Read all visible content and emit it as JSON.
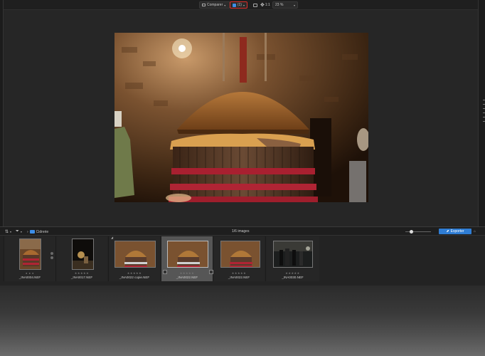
{
  "toolbar": {
    "compare_label": "Comparer",
    "view_mode_label": "(1)",
    "ratio_label": "1:1",
    "zoom_value": "23 %"
  },
  "filmstrip_bar": {
    "folder_name": "Cidrerie",
    "image_count": "1/6 images",
    "export_label": "Exporter"
  },
  "thumbnails": [
    {
      "filename": "_INA0004.NEF",
      "stars": "● ● ●",
      "selected": false
    },
    {
      "filename": "_INA0017.NEF",
      "stars": "★★★★★",
      "selected": false
    },
    {
      "filename": "_INA0022 copie.NEF",
      "stars": "★★★★★",
      "selected": false
    },
    {
      "filename": "_INA0022.NEF",
      "stars": "★★★★★",
      "selected": true
    },
    {
      "filename": "_INA0022.NEF",
      "stars": "★★★★★",
      "selected": false
    },
    {
      "filename": "_INA0030.NEF",
      "stars": "★★★★★",
      "selected": false
    }
  ],
  "colors": {
    "accent_blue": "#2f7dd4",
    "highlight_red": "#e0302b",
    "background": "#262626"
  }
}
